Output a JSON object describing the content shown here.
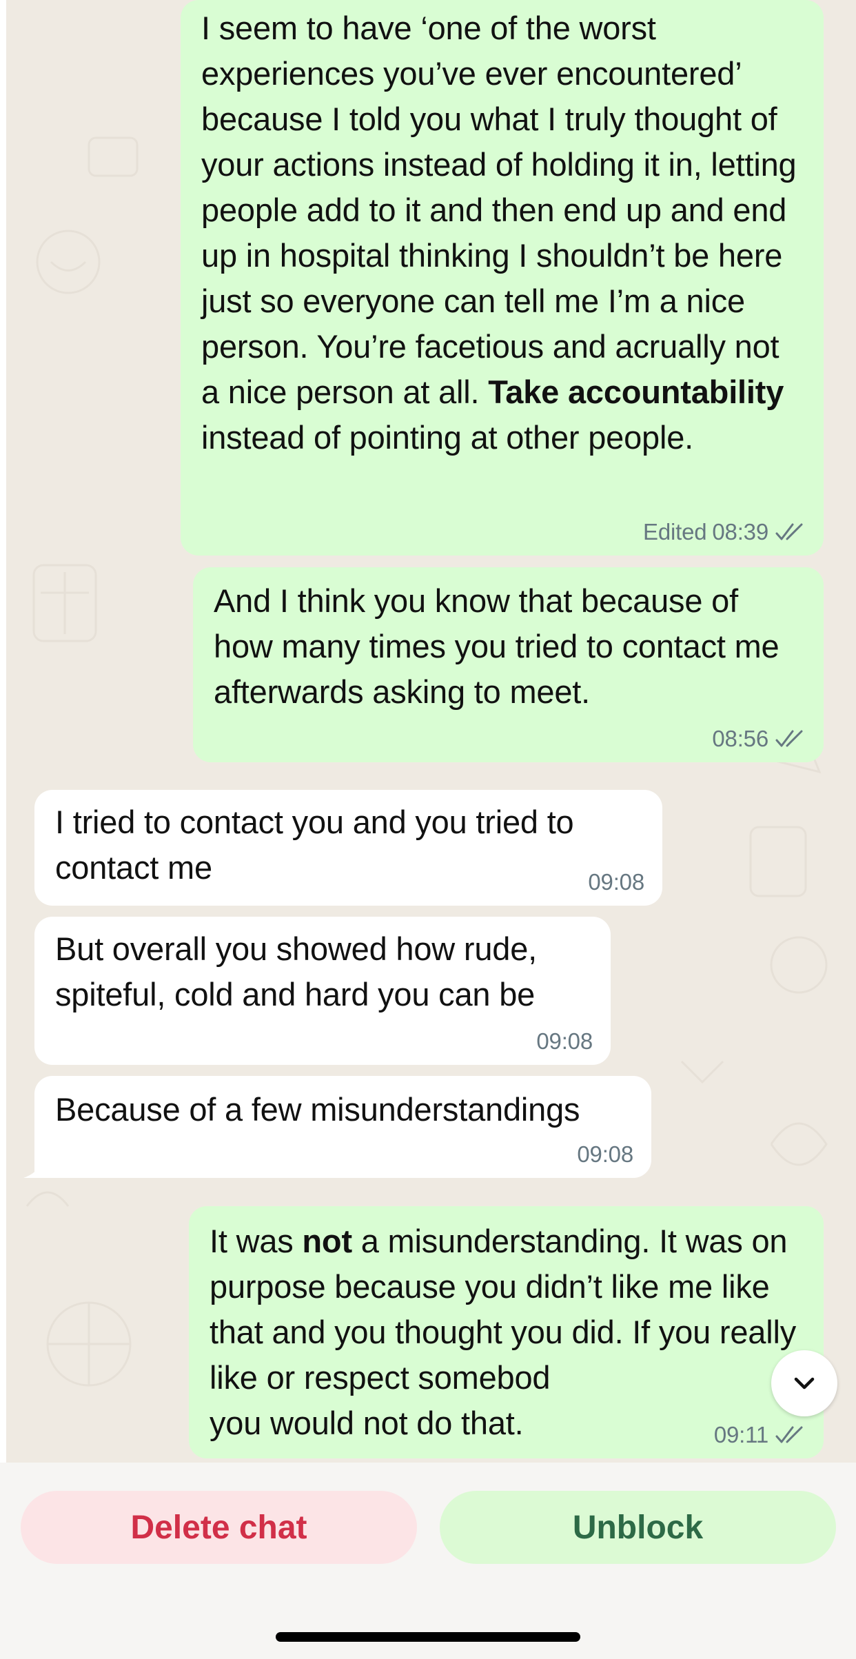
{
  "messages": [
    {
      "direction": "outgoing",
      "segments": [
        "I seem to have ‘one of the worst experiences you’ve ever encountered’ because I told you what I truly thought of your actions instead of holding it in, letting people add to it and then end up and end up in hospital thinking I shouldn’t be here just so everyone can tell me I’m a nice person. You’re facetious and acrually not a nice person at all. ",
        "Take accountability",
        " instead of pointing at other people."
      ],
      "edited_label": "Edited",
      "time": "08:39",
      "status": "read-double-check"
    },
    {
      "direction": "outgoing",
      "text": "And I think you know that because of how many times you tried to contact me afterwards asking to meet.",
      "time": "08:56",
      "status": "read-double-check"
    },
    {
      "direction": "incoming",
      "text": "I tried to contact you and you tried to contact me",
      "time": "09:08"
    },
    {
      "direction": "incoming",
      "text": "But overall you showed how rude, spiteful, cold and hard you can be",
      "time": "09:08"
    },
    {
      "direction": "incoming",
      "text": "Because of a few misunderstandings",
      "time": "09:08"
    },
    {
      "direction": "outgoing",
      "segments": [
        "It was ",
        "not",
        " a misunderstanding. It was on purpose because you didn’t like me like that and you thought you did. If you really like or respect somebod",
        "you would not do that."
      ],
      "time": "09:11",
      "status": "read-double-check"
    }
  ],
  "scroll_button": {
    "icon": "chevron-down-icon"
  },
  "actions": {
    "delete_label": "Delete chat",
    "unblock_label": "Unblock"
  },
  "colors": {
    "outgoing_bubble": "#d9fdd3",
    "incoming_bubble": "#ffffff",
    "chat_background": "#efeae2",
    "delete_text": "#d12f48",
    "delete_bg": "#fce4e6",
    "unblock_text": "#2d6a46",
    "unblock_bg": "#dcfad4",
    "timestamp": "#667781"
  }
}
